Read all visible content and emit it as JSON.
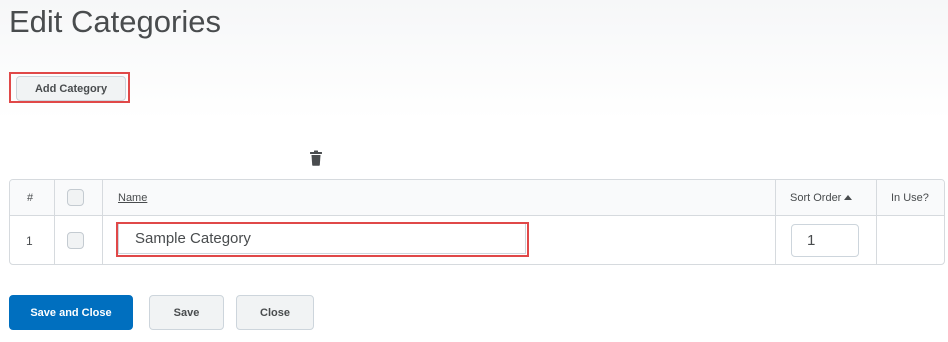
{
  "page": {
    "title": "Edit Categories"
  },
  "toolbar": {
    "add_category_label": "Add Category",
    "delete_icon": "trash-icon"
  },
  "table": {
    "columns": {
      "number": "#",
      "name": "Name",
      "sort_order": "Sort Order",
      "in_use": "In Use?"
    },
    "rows": [
      {
        "number": "1",
        "name": "Sample Category",
        "sort_order": "1",
        "in_use": ""
      }
    ]
  },
  "footer": {
    "save_and_close_label": "Save and Close",
    "save_label": "Save",
    "close_label": "Close"
  },
  "colors": {
    "primary": "#006fbf",
    "highlight": "#e04848",
    "text": "#494c4e"
  }
}
